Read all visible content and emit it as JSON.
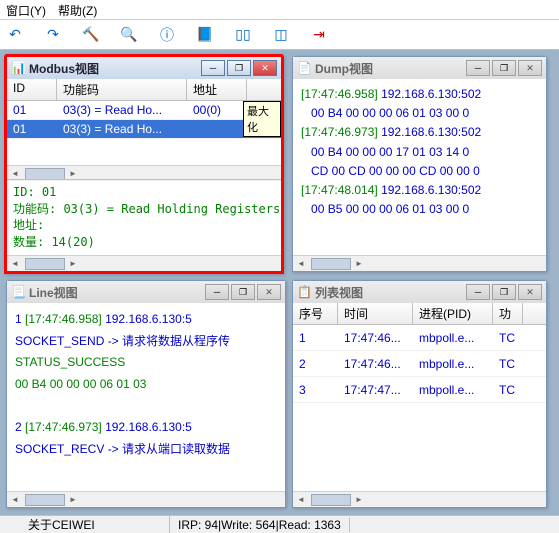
{
  "menu": {
    "window": "窗口(Y)",
    "help": "帮助(Z)"
  },
  "status": {
    "about": "关于CEIWEI",
    "irp": "IRP: 94|Write: 564|Read: 1363"
  },
  "tooltip": "最大化",
  "modbus": {
    "title": "Modbus视图",
    "headers": {
      "id": "ID",
      "func": "功能码",
      "addr": "地址"
    },
    "rows": [
      {
        "id": "01",
        "func": "03(3) = Read Ho...",
        "addr": "00(0)",
        "sel": false
      },
      {
        "id": "01",
        "func": "03(3) = Read Ho...",
        "addr": "",
        "sel": true
      }
    ],
    "detail": "ID: 01\n功能码: 03(3) = Read Holding Registers\n地址:\n数量: 14(20)"
  },
  "dump": {
    "title": "Dump视图",
    "lines": [
      {
        "ts": "[17:47:46.958]",
        "body": " 192.168.6.130:502"
      },
      {
        "ts": "",
        "body": "   00 B4 00 00 00 06 01 03 00 0"
      },
      {
        "ts": "[17:47:46.973]",
        "body": " 192.168.6.130:502"
      },
      {
        "ts": "",
        "body": "   00 B4 00 00 00 17 01 03 14 0"
      },
      {
        "ts": "",
        "body": "   CD 00 CD 00 00 00 CD 00 00 0"
      },
      {
        "ts": "[17:47:48.014]",
        "body": " 192.168.6.130:502"
      },
      {
        "ts": "",
        "body": "   00 B5 00 00 00 06 01 03 00 0"
      }
    ]
  },
  "line": {
    "title": "Line视图",
    "rows": [
      {
        "n": "1",
        "ts": "[17:47:46.958]",
        "ip": "192.168.6.130:5"
      },
      {
        "s": "SOCKET_SEND -> 请求将数据从程序传"
      },
      {
        "g": "    STATUS_SUCCESS"
      },
      {
        "g": "        00 B4 00 00 00 06 01 03"
      },
      {
        "sp": true
      },
      {
        "n": "2",
        "ts": "[17:47:46.973]",
        "ip": "192.168.6.130:5"
      },
      {
        "s": "SOCKET_RECV -> 请求从端口读取数据"
      }
    ]
  },
  "list": {
    "title": "列表视图",
    "headers": {
      "seq": "序号",
      "time": "时间",
      "proc": "进程(PID)",
      "fn": "功"
    },
    "rows": [
      {
        "seq": "1",
        "time": "17:47:46...",
        "proc": "mbpoll.e...",
        "fn": "TC"
      },
      {
        "seq": "2",
        "time": "17:47:46...",
        "proc": "mbpoll.e...",
        "fn": "TC"
      },
      {
        "seq": "3",
        "time": "17:47:47...",
        "proc": "mbpoll.e...",
        "fn": "TC"
      }
    ]
  }
}
